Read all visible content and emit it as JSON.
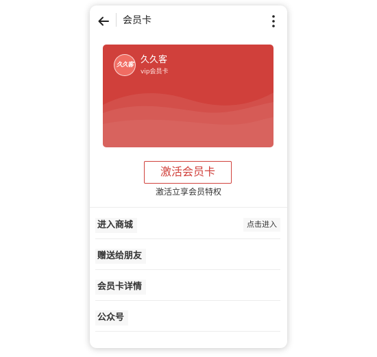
{
  "header": {
    "title": "会员卡"
  },
  "card": {
    "logo_text": "久久客",
    "name": "久久客",
    "subtitle": "vip会员卡",
    "color": "#d0403b"
  },
  "activate": {
    "button_label": "激活会员卡",
    "hint": "激活立享会员特权"
  },
  "menu": {
    "items": [
      {
        "label": "进入商城",
        "value": "点击进入"
      },
      {
        "label": "赠送给朋友"
      },
      {
        "label": "会员卡详情"
      },
      {
        "label": "公众号"
      }
    ]
  }
}
